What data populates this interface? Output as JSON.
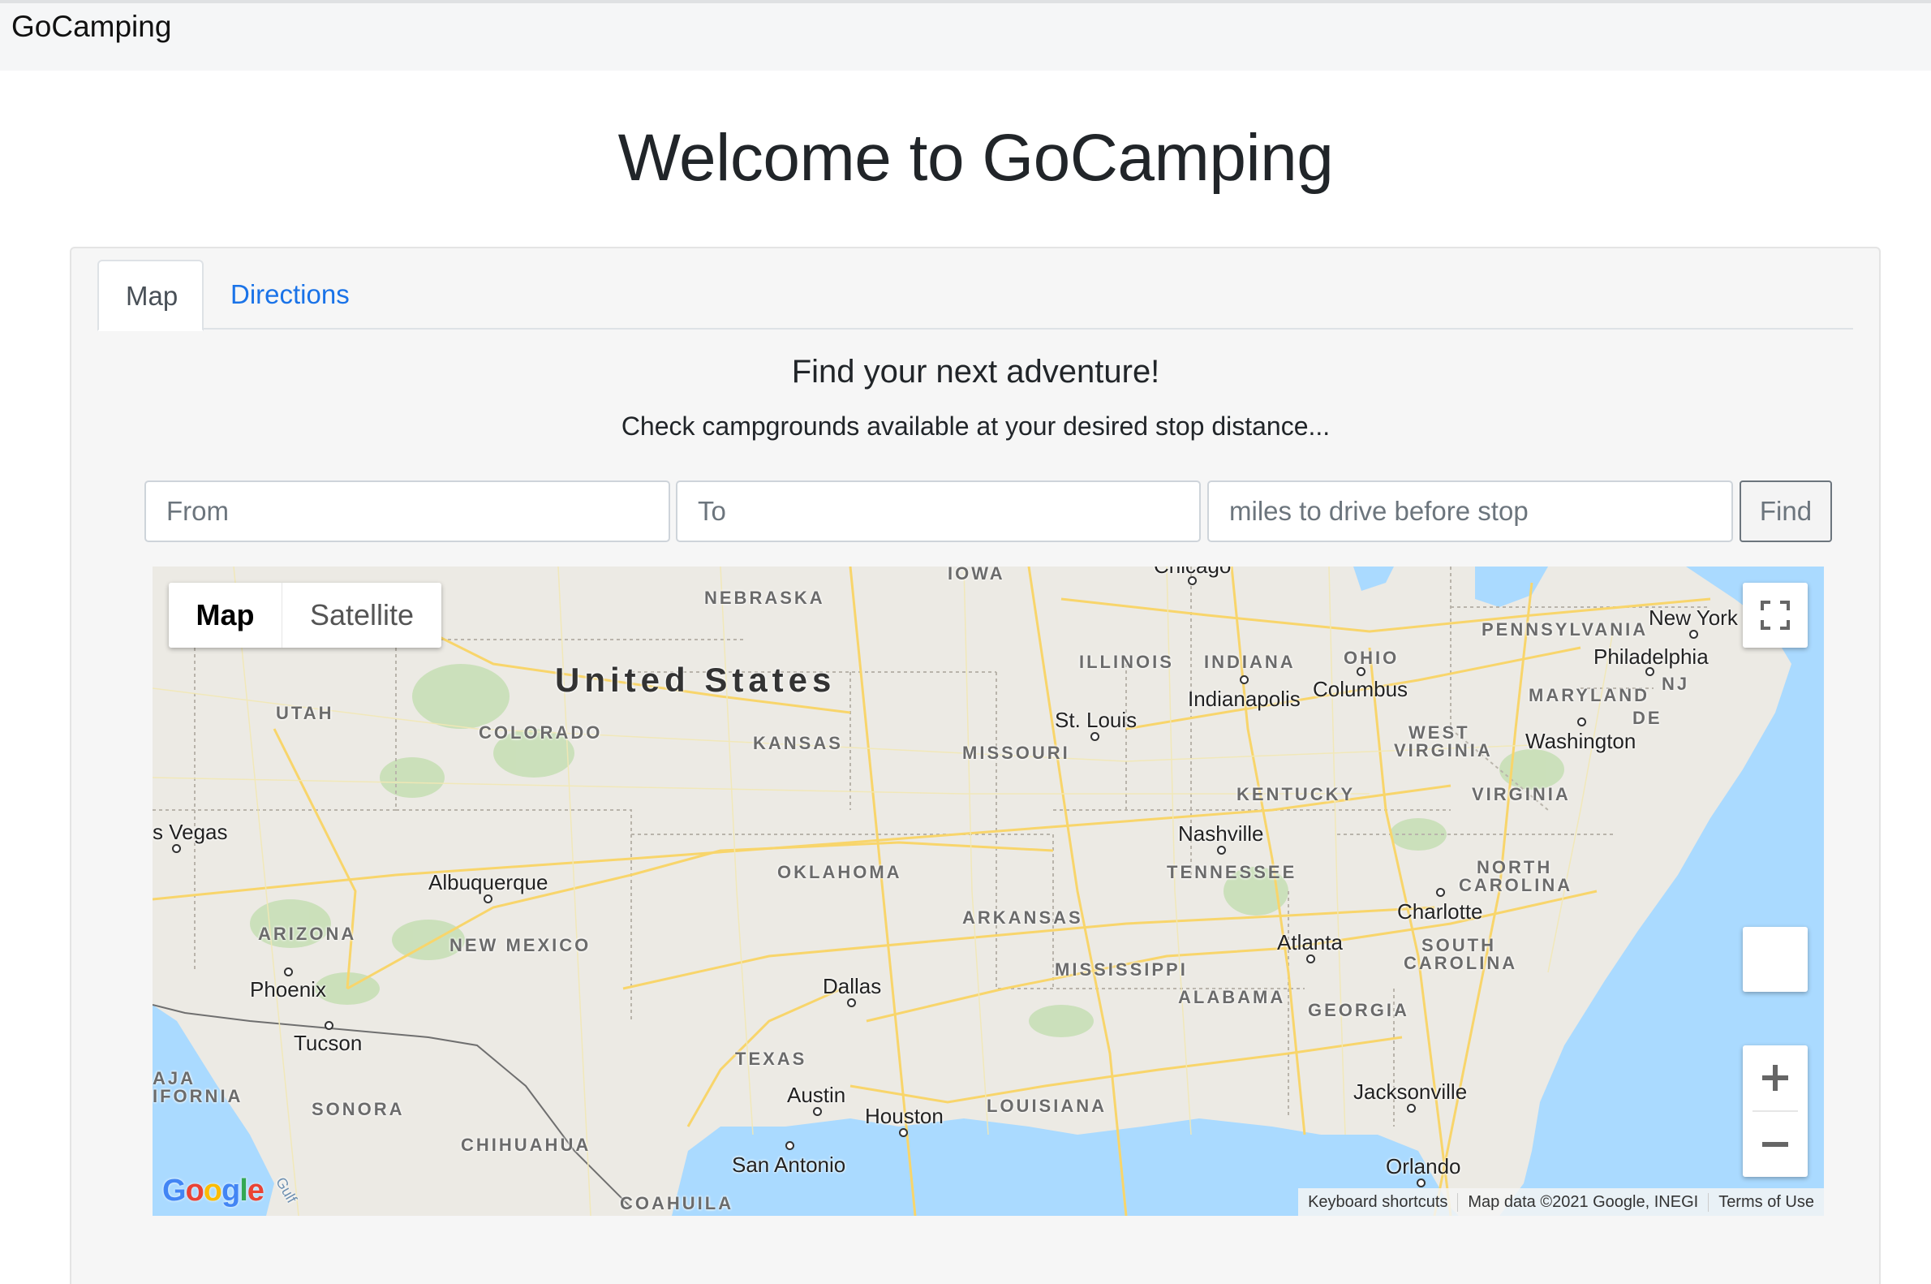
{
  "app": {
    "brand": "GoCamping"
  },
  "header": {
    "title": "Welcome to GoCamping"
  },
  "tabs": [
    {
      "label": "Map"
    },
    {
      "label": "Directions"
    }
  ],
  "finder": {
    "heading": "Find your next adventure!",
    "subtext": "Check campgrounds available at your desired stop distance...",
    "from_placeholder": "From",
    "to_placeholder": "To",
    "miles_placeholder": "miles to drive before stop",
    "find_label": "Find"
  },
  "map": {
    "map_type": {
      "map": "Map",
      "satellite": "Satellite",
      "selected": "Map"
    },
    "country_label": "United States",
    "state_labels": {
      "iowa": "IOWA",
      "nebraska": "NEBRASKA",
      "utah": "UTAH",
      "colorado": "COLORADO",
      "kansas": "KANSAS",
      "missouri": "MISSOURI",
      "illinois": "ILLINOIS",
      "indiana": "INDIANA",
      "ohio": "OHIO",
      "pennsylvania": "PENNSYLVANIA",
      "maryland": "MARYLAND",
      "nj": "NJ",
      "de": "DE",
      "west_virginia_1": "WEST",
      "west_virginia_2": "VIRGINIA",
      "virginia": "VIRGINIA",
      "kentucky": "KENTUCKY",
      "tennessee": "TENNESSEE",
      "north_carolina_1": "NORTH",
      "north_carolina_2": "CAROLINA",
      "south_carolina_1": "SOUTH",
      "south_carolina_2": "CAROLINA",
      "oklahoma": "OKLAHOMA",
      "arkansas": "ARKANSAS",
      "mississippi": "MISSISSIPPI",
      "alabama": "ALABAMA",
      "georgia": "GEORGIA",
      "arizona": "ARIZONA",
      "new_mexico": "NEW MEXICO",
      "texas": "TEXAS",
      "louisiana": "LOUISIANA",
      "sonora": "SONORA",
      "chihuahua": "CHIHUAHUA",
      "coahuila": "COAHUILA",
      "baja_1": "AJA",
      "baja_2": "IFORNIA"
    },
    "city_labels": {
      "chicago": "Chicago",
      "new_york": "New York",
      "philadelphia": "Philadelphia",
      "indianapolis": "Indianapolis",
      "columbus": "Columbus",
      "st_louis": "St. Louis",
      "washington": "Washington",
      "las_vegas": "s Vegas",
      "albuquerque": "Albuquerque",
      "nashville": "Nashville",
      "charlotte": "Charlotte",
      "atlanta": "Atlanta",
      "phoenix": "Phoenix",
      "tucson": "Tucson",
      "dallas": "Dallas",
      "austin": "Austin",
      "houston": "Houston",
      "san_antonio": "San Antonio",
      "jacksonville": "Jacksonville",
      "orlando": "Orlando"
    },
    "google_logo": "Google",
    "gulf_label": "Gulf",
    "attribution": {
      "shortcuts": "Keyboard shortcuts",
      "data": "Map data ©2021 Google, INEGI",
      "terms": "Terms of Use"
    },
    "icons": [
      "fullscreen-icon",
      "pegman-icon",
      "plus-icon",
      "minus-icon"
    ],
    "colors": {
      "water": "#aadaff",
      "land": "#eceae4",
      "roads": "#f8d56b",
      "parks": "#c8dfb6"
    }
  }
}
